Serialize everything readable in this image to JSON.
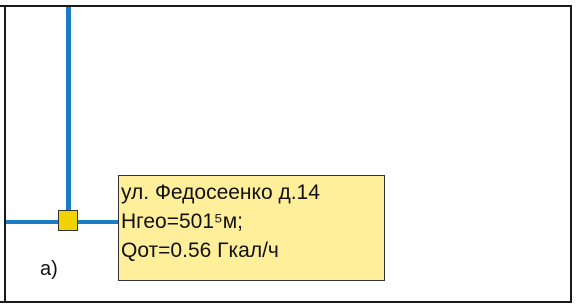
{
  "diagram": {
    "label_lines": [
      "ул. Федосеенко д.14",
      "Hгео=501⁵м;",
      "Qот=0.56 Гкал/ч"
    ],
    "figure_mark": "а)"
  },
  "colors": {
    "pipe": "#1a7cc2",
    "node_fill": "#f2d200",
    "label_fill": "#ffee9a",
    "frame": "#1a1a1a"
  }
}
